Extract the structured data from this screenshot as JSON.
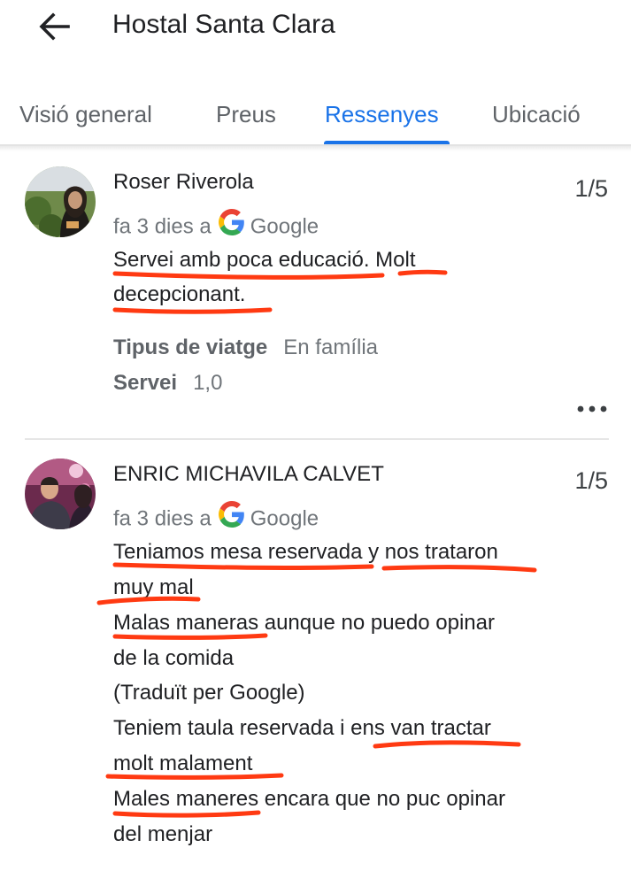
{
  "header": {
    "title": "Hostal Santa Clara",
    "back_icon": "arrow-left-icon"
  },
  "tabs": [
    {
      "label": "Visió general",
      "active": false
    },
    {
      "label": "Preus",
      "active": false
    },
    {
      "label": "Ressenyes",
      "active": true
    },
    {
      "label": "Ubicació",
      "active": false
    }
  ],
  "reviews": [
    {
      "author": "Roser Riverola",
      "rating": "1/5",
      "time": "fa 3 dies a",
      "source": "Google",
      "text_lines": [
        "Servei amb poca educació. Molt",
        "decepcionant."
      ],
      "attributes": [
        {
          "key": "Tipus de viatge",
          "value": "En família"
        },
        {
          "key": "Servei",
          "value": "1,0"
        }
      ]
    },
    {
      "author": "ENRIC MICHAVILA CALVET",
      "rating": "1/5",
      "time": "fa 3 dies a",
      "source": "Google",
      "text_lines": [
        "Teniamos mesa reservada y nos trataron",
        "muy mal",
        "Malas maneras aunque no puedo opinar",
        "de la comida",
        "(Traduït per Google)",
        "Teniem taula reservada i ens van tractar",
        "molt malament",
        "Males maneres encara que no puc opinar",
        "del menjar"
      ]
    }
  ],
  "colors": {
    "accent": "#1a73e8",
    "highlight_marker": "#ff3a12",
    "text": "#202124",
    "secondary": "#70757a"
  }
}
